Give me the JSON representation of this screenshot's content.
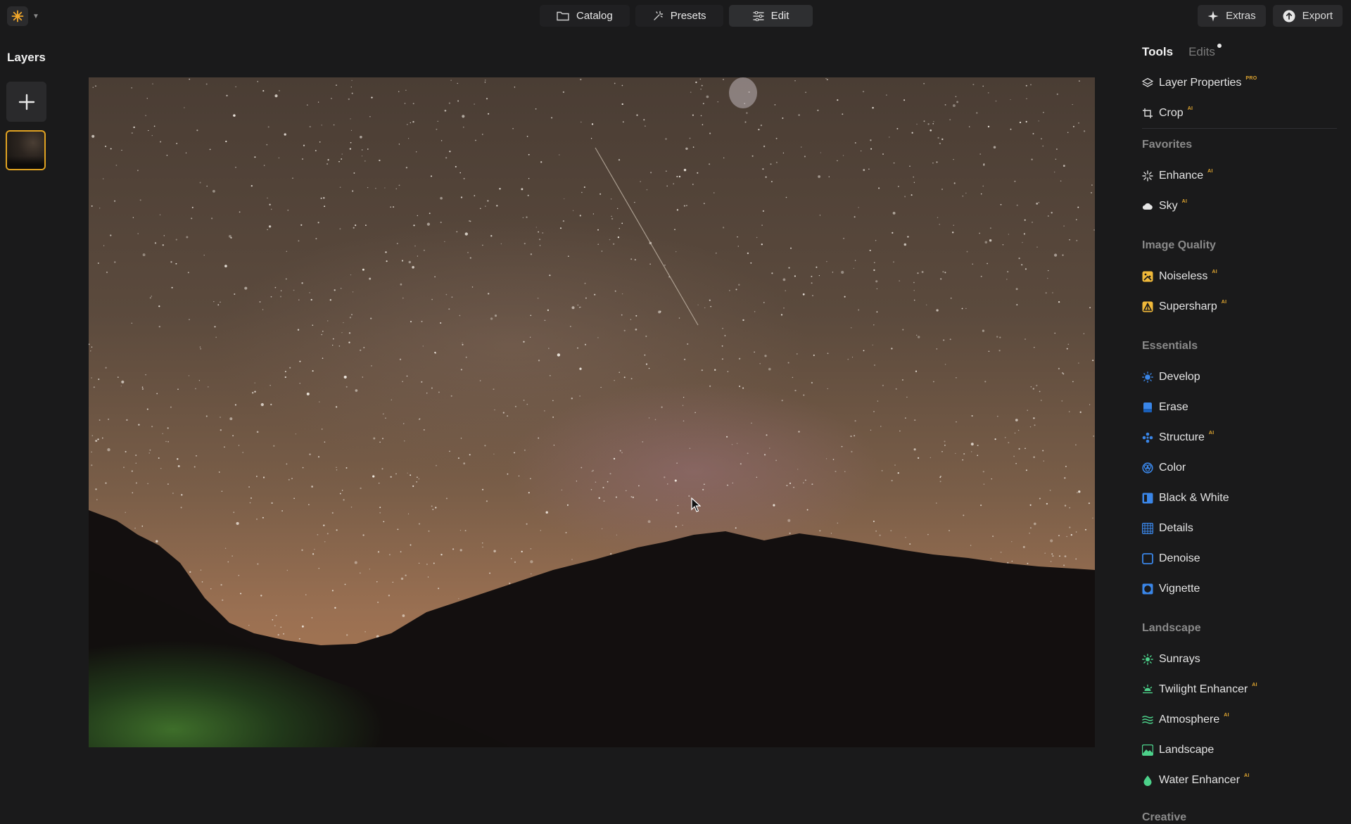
{
  "topbar": {
    "modes": [
      {
        "label": "Catalog",
        "icon": "folder-icon"
      },
      {
        "label": "Presets",
        "icon": "sparkle-icon"
      },
      {
        "label": "Edit",
        "icon": "sliders-icon",
        "active": true
      }
    ],
    "extras_label": "Extras",
    "export_label": "Export"
  },
  "layers": {
    "title": "Layers"
  },
  "right_panel": {
    "tabs": [
      {
        "label": "Tools",
        "active": true
      },
      {
        "label": "Edits",
        "has_dot": true
      }
    ],
    "top_tools": [
      {
        "label": "Layer Properties",
        "badge": "PRO",
        "icon": "layers-stack-icon"
      },
      {
        "label": "Crop",
        "badge": "AI",
        "icon": "crop-icon"
      }
    ],
    "sections": [
      {
        "title": "Favorites",
        "tools": [
          {
            "label": "Enhance",
            "badge": "AI",
            "icon": "enhance-sparkle-icon"
          },
          {
            "label": "Sky",
            "badge": "AI",
            "icon": "cloud-icon"
          }
        ]
      },
      {
        "title": "Image Quality",
        "tools": [
          {
            "label": "Noiseless",
            "badge": "AI",
            "icon": "noiseless-icon"
          },
          {
            "label": "Supersharp",
            "badge": "AI",
            "icon": "supersharp-icon"
          }
        ]
      },
      {
        "title": "Essentials",
        "tools": [
          {
            "label": "Develop",
            "badge": "",
            "icon": "develop-sun-icon"
          },
          {
            "label": "Erase",
            "badge": "",
            "icon": "eraser-icon"
          },
          {
            "label": "Structure",
            "badge": "AI",
            "icon": "structure-icon"
          },
          {
            "label": "Color",
            "badge": "",
            "icon": "color-icon"
          },
          {
            "label": "Black & White",
            "badge": "",
            "icon": "black-white-icon"
          },
          {
            "label": "Details",
            "badge": "",
            "icon": "details-icon"
          },
          {
            "label": "Denoise",
            "badge": "",
            "icon": "denoise-icon"
          },
          {
            "label": "Vignette",
            "badge": "",
            "icon": "vignette-icon"
          }
        ]
      },
      {
        "title": "Landscape",
        "tools": [
          {
            "label": "Sunrays",
            "badge": "",
            "icon": "sunrays-icon"
          },
          {
            "label": "Twilight Enhancer",
            "badge": "AI",
            "icon": "twilight-icon"
          },
          {
            "label": "Atmosphere",
            "badge": "AI",
            "icon": "atmosphere-icon"
          },
          {
            "label": "Landscape",
            "badge": "",
            "icon": "landscape-icon"
          },
          {
            "label": "Water Enhancer",
            "badge": "AI",
            "icon": "water-drop-icon"
          }
        ]
      },
      {
        "title": "Creative",
        "tools": []
      }
    ]
  },
  "colors": {
    "background": "#1a1a1b",
    "accent_orange": "#e1a322",
    "ai_icon_yellow": "#f0b93a",
    "essentials_blue": "#3a86e8",
    "landscape_green": "#4cd18a"
  }
}
